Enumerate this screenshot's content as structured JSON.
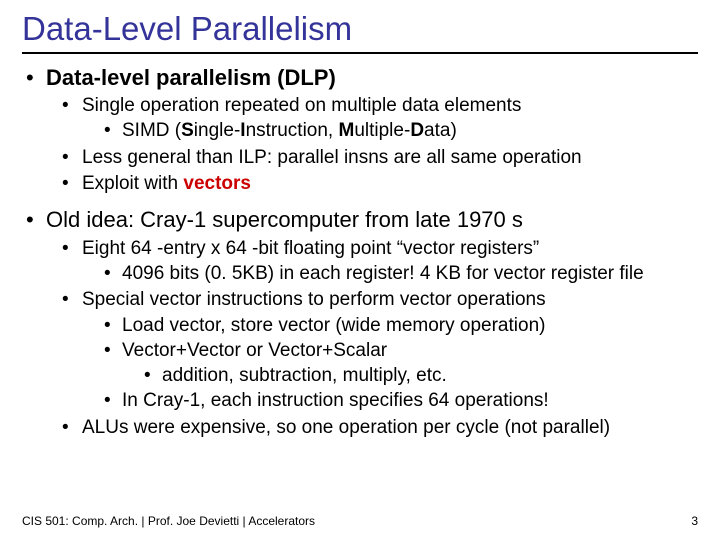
{
  "title": "Data-Level Parallelism",
  "b1": "Data-level parallelism (DLP)",
  "b1_1": "Single operation repeated on multiple data elements",
  "b1_1_1_a": "SIMD (",
  "b1_1_1_b": "S",
  "b1_1_1_c": "ingle-",
  "b1_1_1_d": "I",
  "b1_1_1_e": "nstruction, ",
  "b1_1_1_f": "M",
  "b1_1_1_g": "ultiple-",
  "b1_1_1_h": "D",
  "b1_1_1_i": "ata)",
  "b1_2": "Less general than ILP: parallel insns are all same operation",
  "b1_3_a": "Exploit with ",
  "b1_3_b": "vectors",
  "b2": "Old idea: Cray-1 supercomputer from late 1970 s",
  "b2_1": "Eight 64 -entry x 64 -bit floating point “vector registers”",
  "b2_1_1": "4096 bits (0. 5KB) in each register!  4 KB for vector register file",
  "b2_2": "Special vector instructions to perform vector operations",
  "b2_2_1": "Load vector, store vector (wide memory operation)",
  "b2_2_2": "Vector+Vector or Vector+Scalar",
  "b2_2_2_1": "addition, subtraction, multiply, etc.",
  "b2_2_3": "In Cray-1, each instruction specifies 64 operations!",
  "b2_3": "ALUs were expensive, so one operation per cycle (not parallel)",
  "footer_left": "CIS 501: Comp. Arch.  |  Prof. Joe Devietti  |  Accelerators",
  "footer_right": "3"
}
